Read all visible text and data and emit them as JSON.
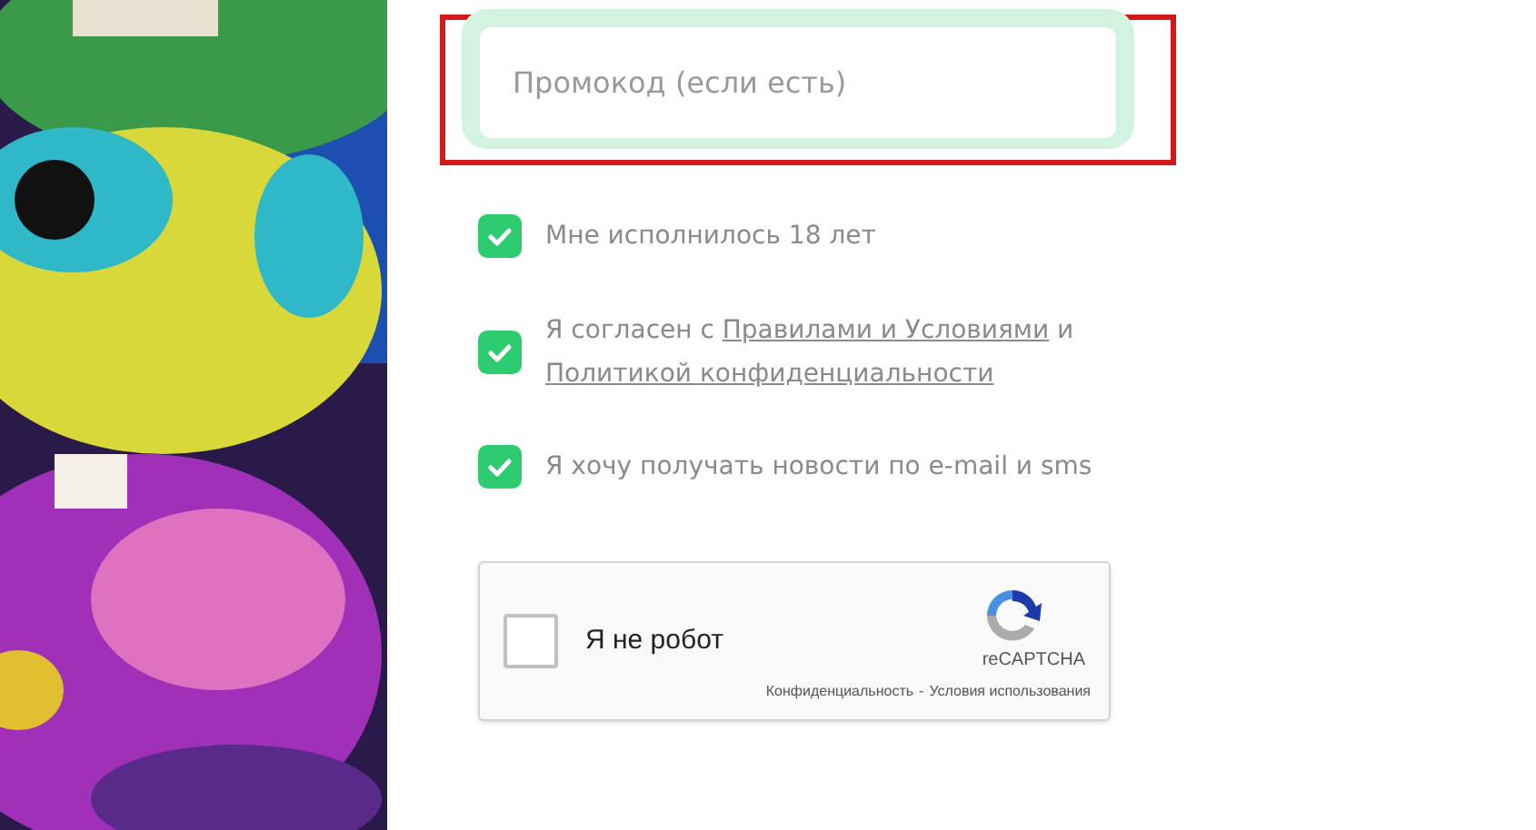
{
  "promo_field": {
    "placeholder": "Промокод (если есть)",
    "highlighted": true
  },
  "checkboxes": [
    {
      "checked": true,
      "parts": [
        {
          "kind": "text",
          "text": "Мне исполнилось 18 лет"
        }
      ]
    },
    {
      "checked": true,
      "parts": [
        {
          "kind": "text",
          "text": "Я согласен с "
        },
        {
          "kind": "link",
          "text": "Правилами и Условиями"
        },
        {
          "kind": "text",
          "text": " и "
        },
        {
          "kind": "link",
          "text": "Политикой конфиденциальности"
        }
      ]
    },
    {
      "checked": true,
      "parts": [
        {
          "kind": "text",
          "text": "Я хочу получать новости по e-mail и sms"
        }
      ]
    }
  ],
  "captcha": {
    "checked": false,
    "label": "Я не робот",
    "brand": "reCAPTCHA",
    "privacy_link": "Конфиденциальность",
    "separator": "-",
    "terms_link": "Условия использования"
  }
}
